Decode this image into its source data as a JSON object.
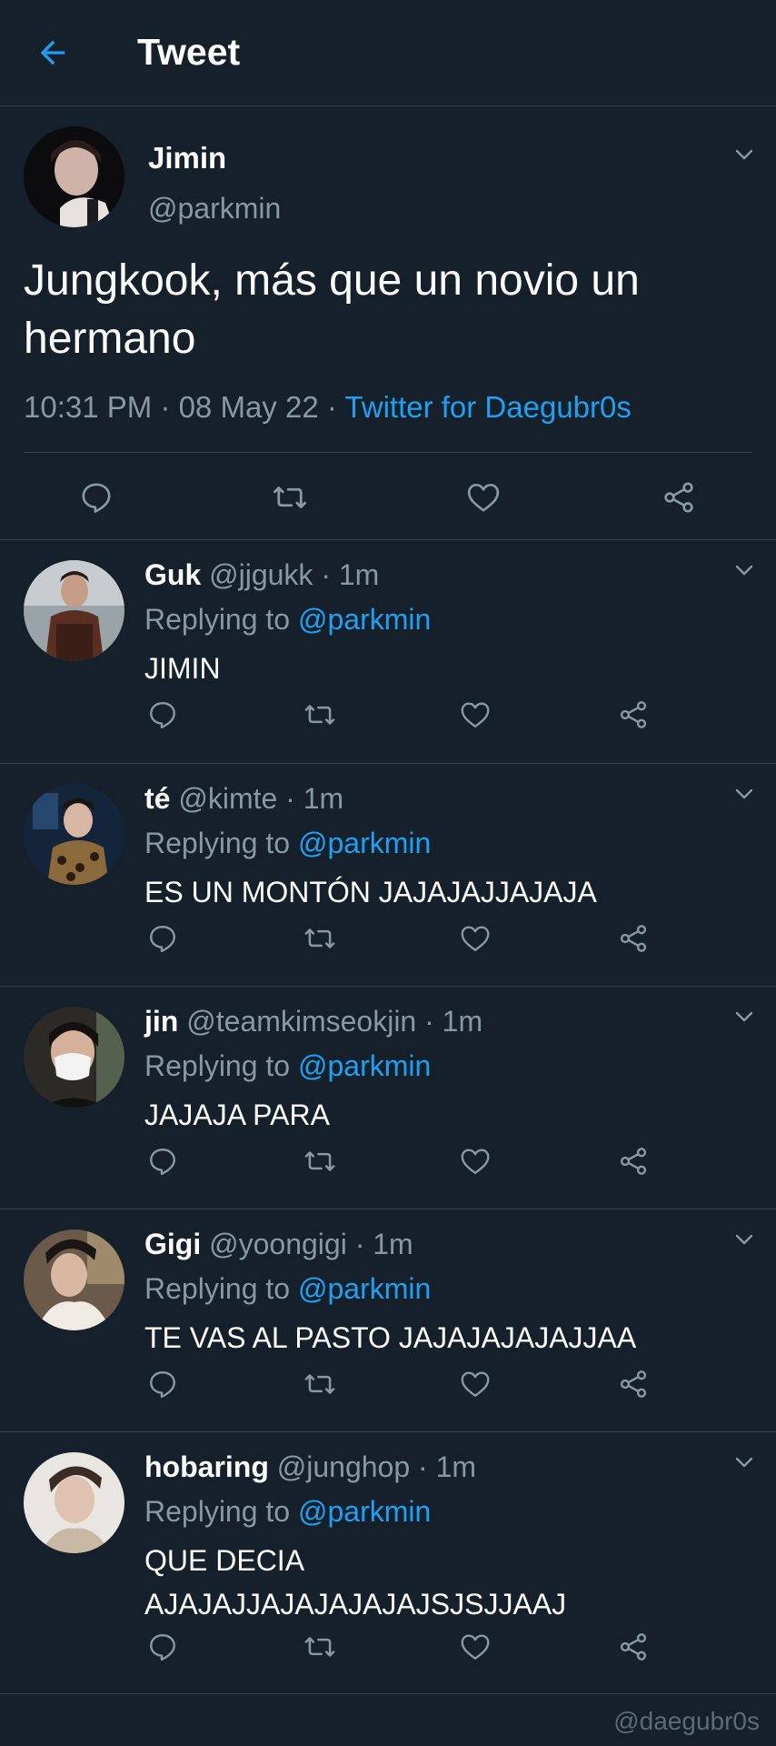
{
  "header": {
    "title": "Tweet"
  },
  "main_tweet": {
    "name": "Jimin",
    "handle": "@parkmin",
    "text": "Jungkook, más que un novio un hermano",
    "time": "10:31 PM · 08 May 22 · ",
    "source": "Twitter for Daegubr0s"
  },
  "replies": [
    {
      "name": "Guk",
      "handle": "@jjgukk",
      "time": " · 1m",
      "replying_label": "Replying to ",
      "mention": "@parkmin",
      "text": "JIMIN"
    },
    {
      "name": "té",
      "handle": "@kimte",
      "time": " · 1m",
      "replying_label": "Replying to ",
      "mention": "@parkmin",
      "text": "ES UN MONTÓN JAJAJAJJAJAJA"
    },
    {
      "name": "jin",
      "handle": "@teamkimseokjin",
      "time": " · 1m",
      "replying_label": "Replying to ",
      "mention": "@parkmin",
      "text": "JAJAJA PARA"
    },
    {
      "name": "Gigi",
      "handle": "@yoongigi",
      "time": " · 1m",
      "replying_label": "Replying to ",
      "mention": "@parkmin",
      "text": "TE VAS AL PASTO JAJAJAJAJAJJAA"
    },
    {
      "name": "hobaring",
      "handle": "@junghop",
      "time": " · 1m",
      "replying_label": "Replying to ",
      "mention": "@parkmin",
      "text": "QUE DECIA AJAJAJJAJAJAJAJAJSJSJJAAJ"
    }
  ],
  "watermark": "@daegubr0s",
  "colors": {
    "background": "#15202b",
    "accent": "#1da1f2",
    "secondary_text": "#8899a6",
    "divider": "#38444d"
  },
  "icons": [
    "back-arrow-icon",
    "chevron-down-icon",
    "reply-icon",
    "retweet-icon",
    "like-icon",
    "share-icon"
  ]
}
